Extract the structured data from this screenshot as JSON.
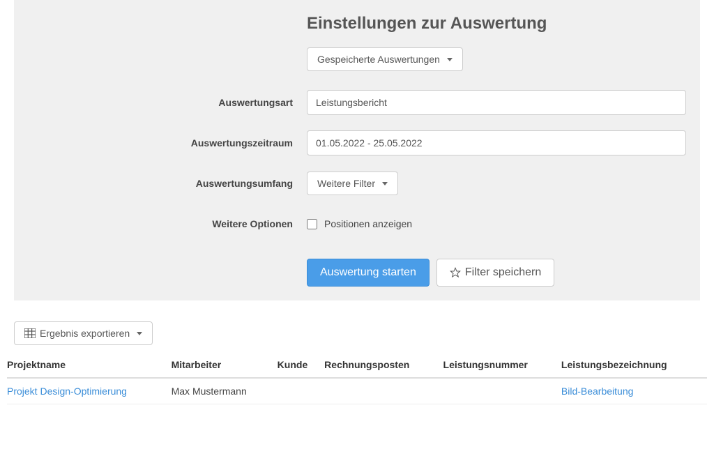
{
  "panel": {
    "title": "Einstellungen zur Auswertung",
    "savedReportsButton": "Gespeicherte Auswertungen",
    "labels": {
      "reportType": "Auswertungsart",
      "reportPeriod": "Auswertungszeitraum",
      "reportScope": "Auswertungsumfang",
      "moreOptions": "Weitere Optionen"
    },
    "values": {
      "reportType": "Leistungsbericht",
      "reportPeriod": "01.05.2022 - 25.05.2022",
      "moreFiltersButton": "Weitere Filter",
      "showPositionsCheckbox": "Positionen anzeigen"
    },
    "actions": {
      "start": "Auswertung starten",
      "saveFilter": "Filter speichern"
    }
  },
  "export": {
    "button": "Ergebnis exportieren"
  },
  "table": {
    "headers": {
      "project": "Projektname",
      "employee": "Mitarbeiter",
      "customer": "Kunde",
      "invoiceItem": "Rechnungsposten",
      "serviceNumber": "Leistungsnummer",
      "serviceName": "Leistungsbezeichnung"
    },
    "rows": [
      {
        "project": "Projekt Design-Optimierung",
        "employee": "Max Mustermann",
        "customer": "",
        "invoiceItem": "",
        "serviceNumber": "",
        "serviceName": "Bild-Bearbeitung"
      }
    ]
  }
}
